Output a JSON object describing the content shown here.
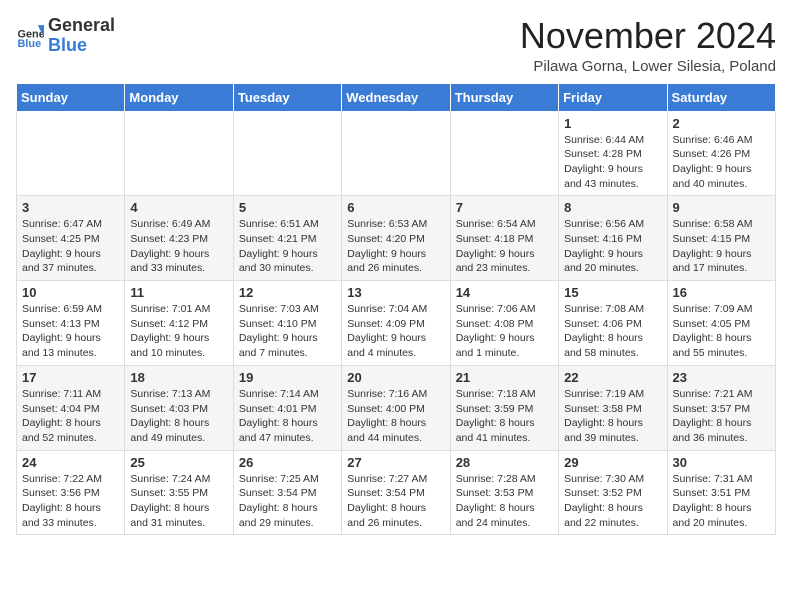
{
  "logo": {
    "general": "General",
    "blue": "Blue"
  },
  "title": {
    "month": "November 2024",
    "location": "Pilawa Gorna, Lower Silesia, Poland"
  },
  "weekdays": [
    "Sunday",
    "Monday",
    "Tuesday",
    "Wednesday",
    "Thursday",
    "Friday",
    "Saturday"
  ],
  "weeks": [
    [
      {
        "day": "",
        "info": ""
      },
      {
        "day": "",
        "info": ""
      },
      {
        "day": "",
        "info": ""
      },
      {
        "day": "",
        "info": ""
      },
      {
        "day": "",
        "info": ""
      },
      {
        "day": "1",
        "info": "Sunrise: 6:44 AM\nSunset: 4:28 PM\nDaylight: 9 hours\nand 43 minutes."
      },
      {
        "day": "2",
        "info": "Sunrise: 6:46 AM\nSunset: 4:26 PM\nDaylight: 9 hours\nand 40 minutes."
      }
    ],
    [
      {
        "day": "3",
        "info": "Sunrise: 6:47 AM\nSunset: 4:25 PM\nDaylight: 9 hours\nand 37 minutes."
      },
      {
        "day": "4",
        "info": "Sunrise: 6:49 AM\nSunset: 4:23 PM\nDaylight: 9 hours\nand 33 minutes."
      },
      {
        "day": "5",
        "info": "Sunrise: 6:51 AM\nSunset: 4:21 PM\nDaylight: 9 hours\nand 30 minutes."
      },
      {
        "day": "6",
        "info": "Sunrise: 6:53 AM\nSunset: 4:20 PM\nDaylight: 9 hours\nand 26 minutes."
      },
      {
        "day": "7",
        "info": "Sunrise: 6:54 AM\nSunset: 4:18 PM\nDaylight: 9 hours\nand 23 minutes."
      },
      {
        "day": "8",
        "info": "Sunrise: 6:56 AM\nSunset: 4:16 PM\nDaylight: 9 hours\nand 20 minutes."
      },
      {
        "day": "9",
        "info": "Sunrise: 6:58 AM\nSunset: 4:15 PM\nDaylight: 9 hours\nand 17 minutes."
      }
    ],
    [
      {
        "day": "10",
        "info": "Sunrise: 6:59 AM\nSunset: 4:13 PM\nDaylight: 9 hours\nand 13 minutes."
      },
      {
        "day": "11",
        "info": "Sunrise: 7:01 AM\nSunset: 4:12 PM\nDaylight: 9 hours\nand 10 minutes."
      },
      {
        "day": "12",
        "info": "Sunrise: 7:03 AM\nSunset: 4:10 PM\nDaylight: 9 hours\nand 7 minutes."
      },
      {
        "day": "13",
        "info": "Sunrise: 7:04 AM\nSunset: 4:09 PM\nDaylight: 9 hours\nand 4 minutes."
      },
      {
        "day": "14",
        "info": "Sunrise: 7:06 AM\nSunset: 4:08 PM\nDaylight: 9 hours\nand 1 minute."
      },
      {
        "day": "15",
        "info": "Sunrise: 7:08 AM\nSunset: 4:06 PM\nDaylight: 8 hours\nand 58 minutes."
      },
      {
        "day": "16",
        "info": "Sunrise: 7:09 AM\nSunset: 4:05 PM\nDaylight: 8 hours\nand 55 minutes."
      }
    ],
    [
      {
        "day": "17",
        "info": "Sunrise: 7:11 AM\nSunset: 4:04 PM\nDaylight: 8 hours\nand 52 minutes."
      },
      {
        "day": "18",
        "info": "Sunrise: 7:13 AM\nSunset: 4:03 PM\nDaylight: 8 hours\nand 49 minutes."
      },
      {
        "day": "19",
        "info": "Sunrise: 7:14 AM\nSunset: 4:01 PM\nDaylight: 8 hours\nand 47 minutes."
      },
      {
        "day": "20",
        "info": "Sunrise: 7:16 AM\nSunset: 4:00 PM\nDaylight: 8 hours\nand 44 minutes."
      },
      {
        "day": "21",
        "info": "Sunrise: 7:18 AM\nSunset: 3:59 PM\nDaylight: 8 hours\nand 41 minutes."
      },
      {
        "day": "22",
        "info": "Sunrise: 7:19 AM\nSunset: 3:58 PM\nDaylight: 8 hours\nand 39 minutes."
      },
      {
        "day": "23",
        "info": "Sunrise: 7:21 AM\nSunset: 3:57 PM\nDaylight: 8 hours\nand 36 minutes."
      }
    ],
    [
      {
        "day": "24",
        "info": "Sunrise: 7:22 AM\nSunset: 3:56 PM\nDaylight: 8 hours\nand 33 minutes."
      },
      {
        "day": "25",
        "info": "Sunrise: 7:24 AM\nSunset: 3:55 PM\nDaylight: 8 hours\nand 31 minutes."
      },
      {
        "day": "26",
        "info": "Sunrise: 7:25 AM\nSunset: 3:54 PM\nDaylight: 8 hours\nand 29 minutes."
      },
      {
        "day": "27",
        "info": "Sunrise: 7:27 AM\nSunset: 3:54 PM\nDaylight: 8 hours\nand 26 minutes."
      },
      {
        "day": "28",
        "info": "Sunrise: 7:28 AM\nSunset: 3:53 PM\nDaylight: 8 hours\nand 24 minutes."
      },
      {
        "day": "29",
        "info": "Sunrise: 7:30 AM\nSunset: 3:52 PM\nDaylight: 8 hours\nand 22 minutes."
      },
      {
        "day": "30",
        "info": "Sunrise: 7:31 AM\nSunset: 3:51 PM\nDaylight: 8 hours\nand 20 minutes."
      }
    ]
  ]
}
